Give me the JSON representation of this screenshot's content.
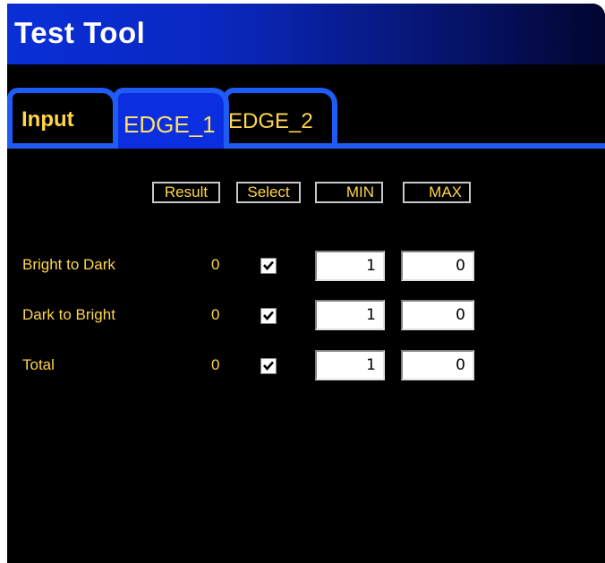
{
  "window": {
    "title": "Test Tool"
  },
  "tabs": [
    {
      "label": "Input",
      "active": false
    },
    {
      "label": "EDGE_1",
      "active": true
    },
    {
      "label": "EDGE_2",
      "active": false
    }
  ],
  "headers": {
    "result": "Result",
    "select": "Select",
    "min": "MIN",
    "max": "MAX"
  },
  "rows": [
    {
      "label": "Bright to Dark",
      "result": "0",
      "selected": true,
      "min": "1",
      "max": "0"
    },
    {
      "label": "Dark to Bright",
      "result": "0",
      "selected": true,
      "min": "1",
      "max": "0"
    },
    {
      "label": "Total",
      "result": "0",
      "selected": true,
      "min": "1",
      "max": "0"
    }
  ],
  "colors": {
    "accent": "#1f5cf5",
    "text": "#ffd64a",
    "background": "#000000"
  }
}
